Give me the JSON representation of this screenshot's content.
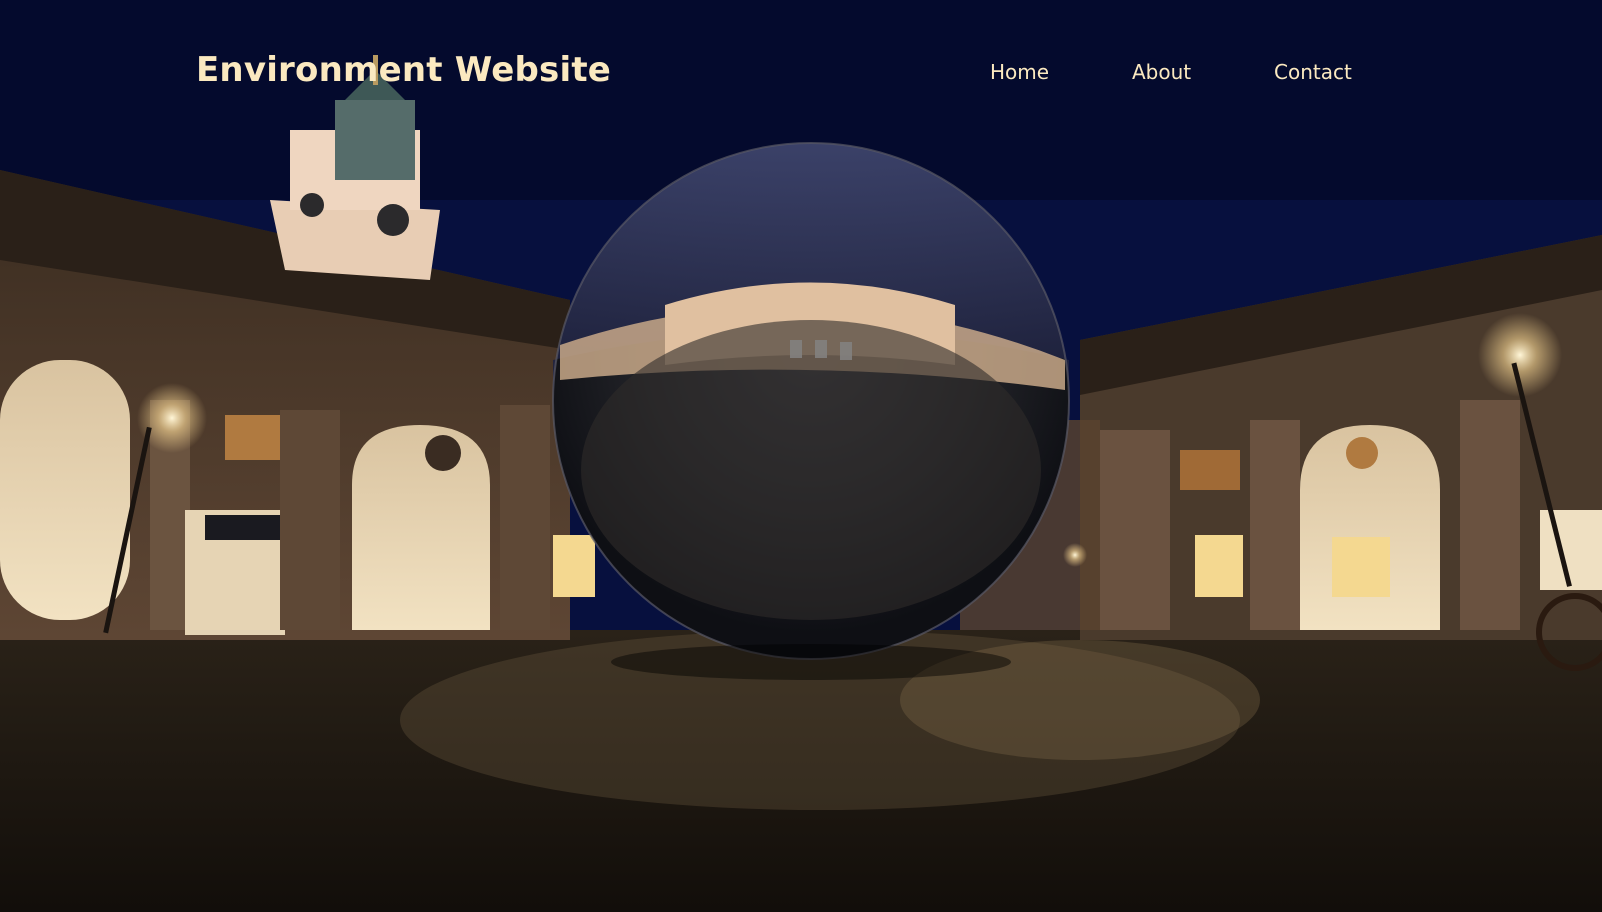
{
  "site": {
    "title": "Environment Website"
  },
  "nav": {
    "items": [
      {
        "label": "Home"
      },
      {
        "label": "About"
      },
      {
        "label": "Contact"
      }
    ]
  },
  "colors": {
    "title_text": "#fbe9c0",
    "nav_text": "#fbe9c0",
    "sky": "#0a1450",
    "ground": "#1a140e"
  },
  "scene": {
    "description_icon": "chrome-sphere-3d"
  }
}
